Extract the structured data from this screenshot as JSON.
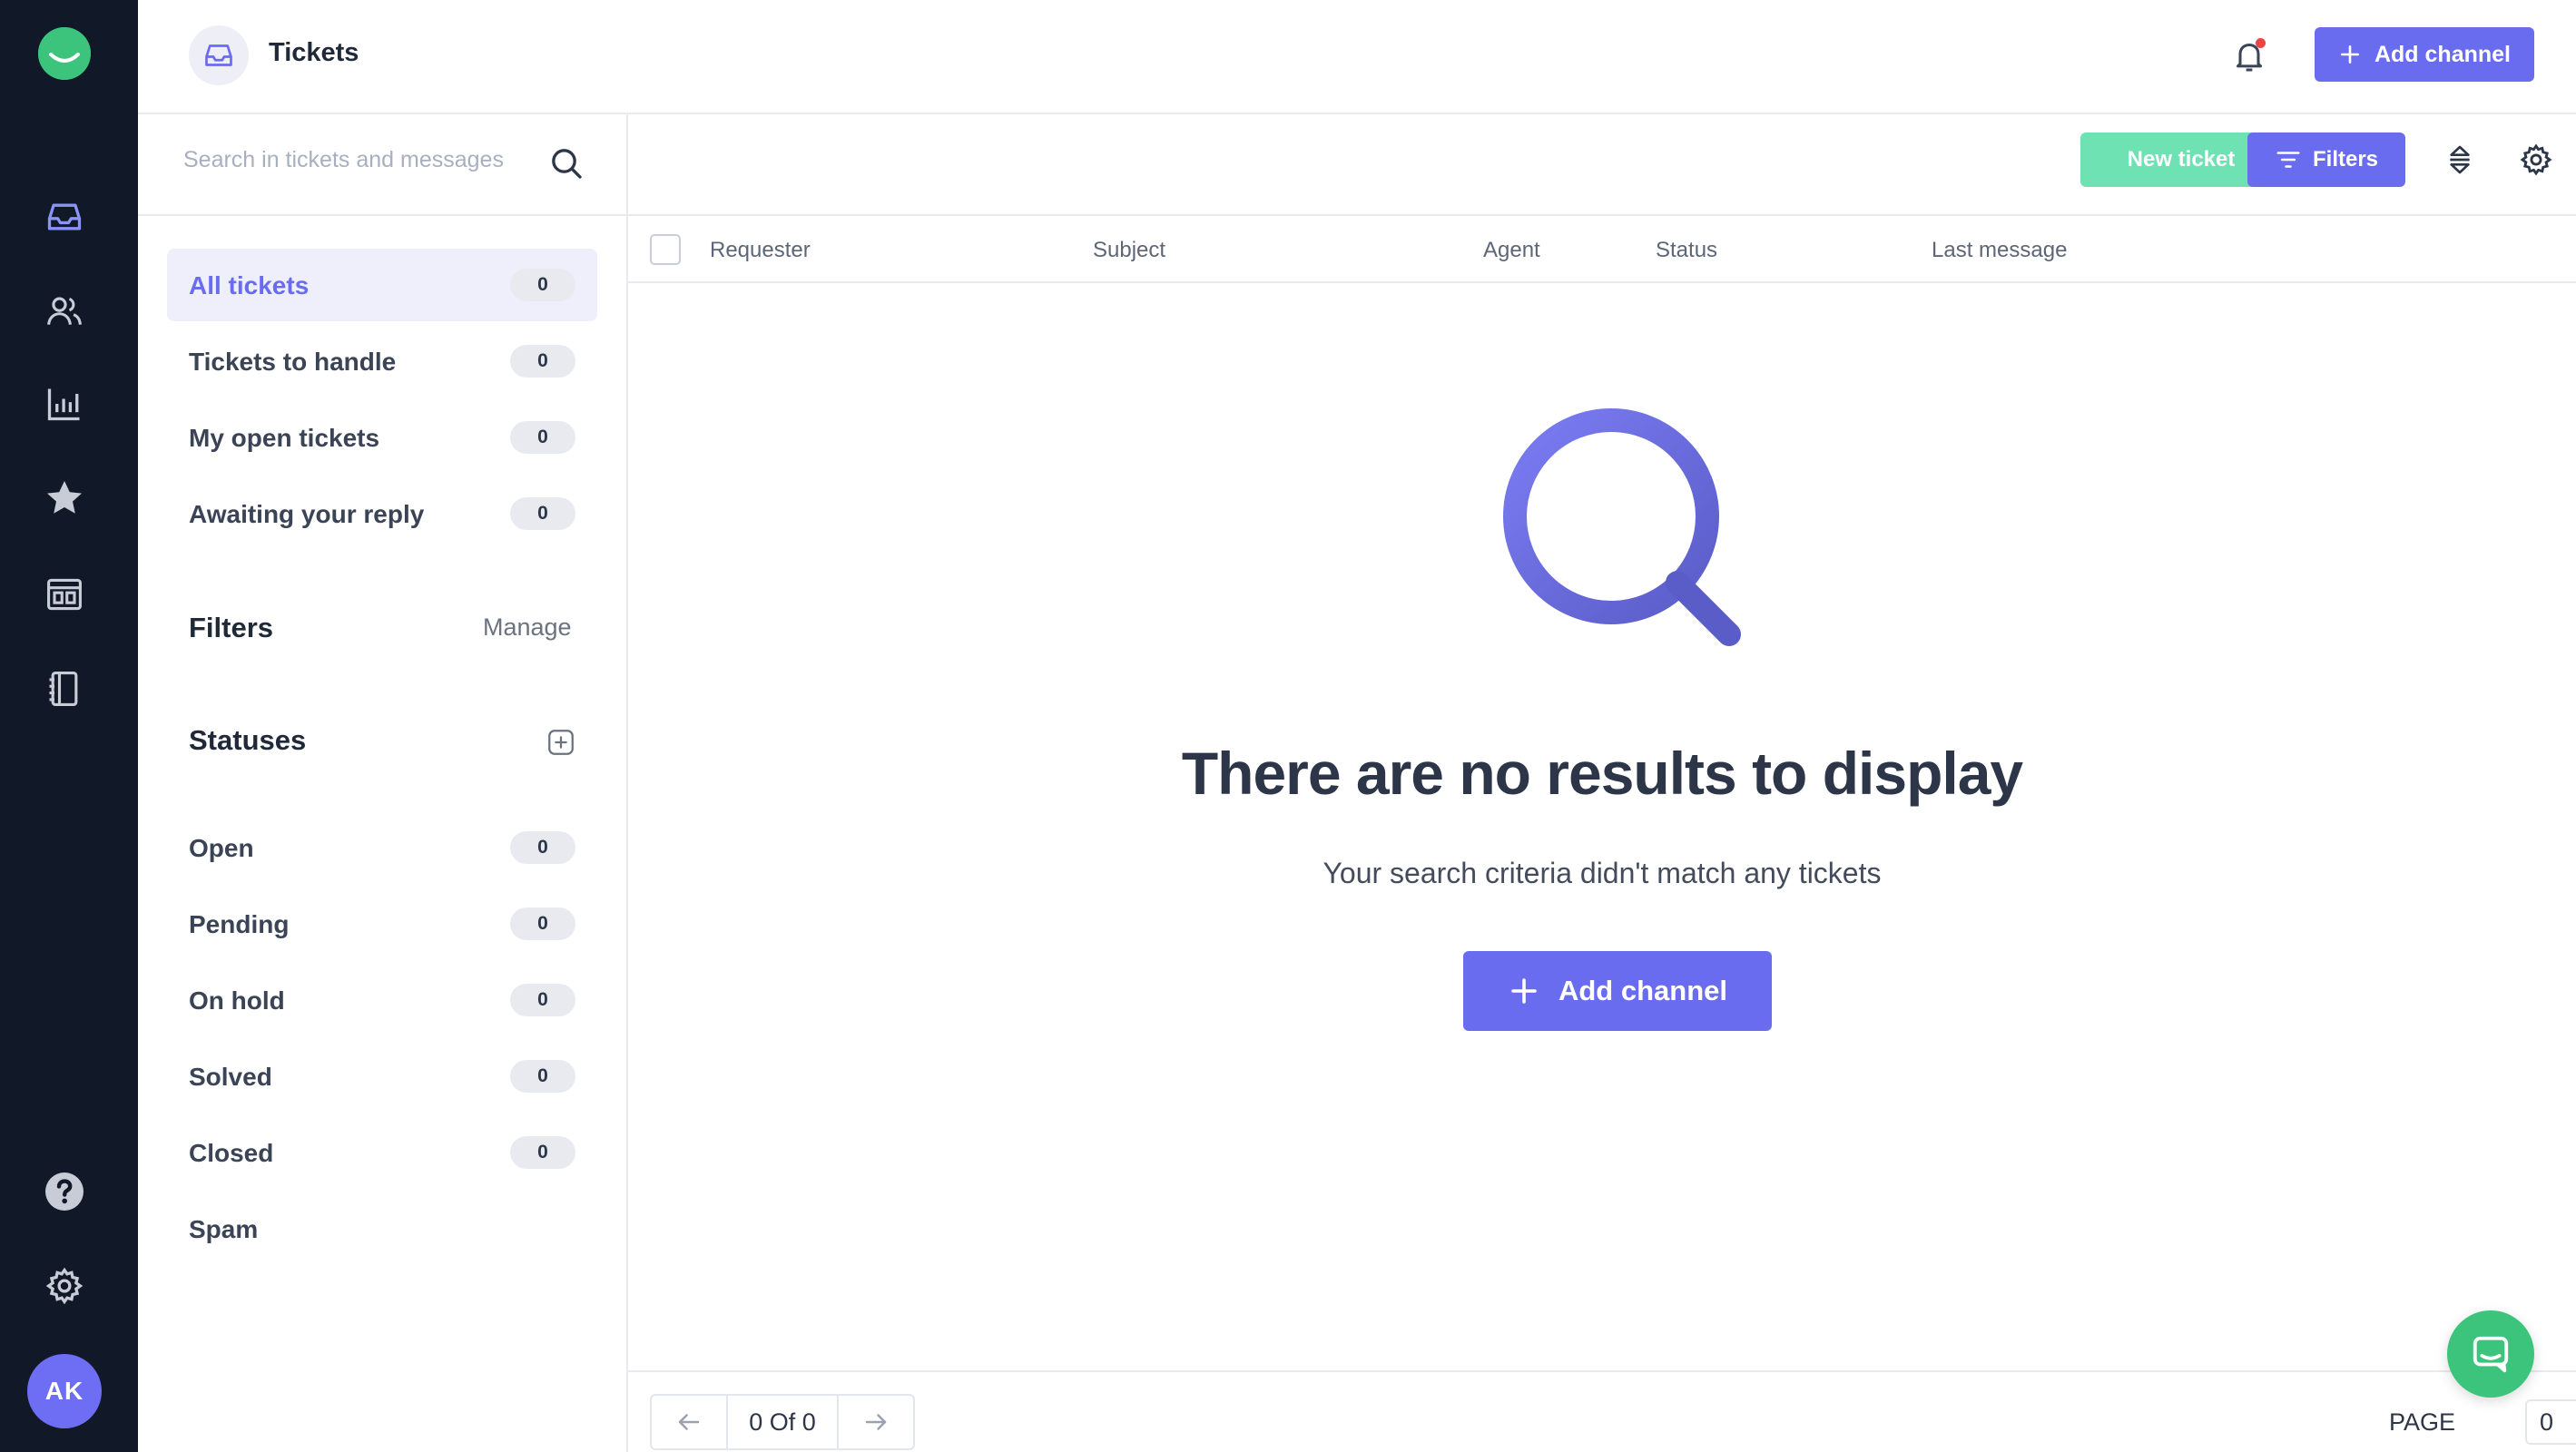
{
  "header": {
    "title": "Tickets",
    "add_channel_label": "Add channel"
  },
  "rail": {
    "items": [
      "inbox-icon",
      "users-icon",
      "bar-chart-icon",
      "star-icon",
      "layout-icon",
      "book-icon"
    ],
    "bottom": [
      "help-icon",
      "gear-icon"
    ],
    "avatar_initials": "AK"
  },
  "search": {
    "placeholder": "Search in tickets and messages"
  },
  "views": [
    {
      "label": "All tickets",
      "count": "0",
      "active": true
    },
    {
      "label": "Tickets to handle",
      "count": "0"
    },
    {
      "label": "My open tickets",
      "count": "0"
    },
    {
      "label": "Awaiting your reply",
      "count": "0"
    }
  ],
  "filters": {
    "title": "Filters",
    "manage_label": "Manage"
  },
  "statuses": {
    "title": "Statuses",
    "items": [
      {
        "label": "Open",
        "count": "0"
      },
      {
        "label": "Pending",
        "count": "0"
      },
      {
        "label": "On hold",
        "count": "0"
      },
      {
        "label": "Solved",
        "count": "0"
      },
      {
        "label": "Closed",
        "count": "0"
      },
      {
        "label": "Spam"
      }
    ]
  },
  "toolbar": {
    "new_ticket_label": "New ticket",
    "filters_label": "Filters"
  },
  "table": {
    "columns": [
      "Requester",
      "Subject",
      "Agent",
      "Status",
      "Last message"
    ]
  },
  "empty": {
    "title": "There are no results to display",
    "subtitle": "Your search criteria didn't match any tickets",
    "button_label": "Add channel"
  },
  "footer": {
    "pager_text": "0 Of 0",
    "page_label": "PAGE",
    "page_value": "0"
  },
  "colors": {
    "accent": "#6a6cf0",
    "brand_green": "#3cc47c",
    "rail_bg": "#111827",
    "new_ticket": "#6fe2b3"
  }
}
